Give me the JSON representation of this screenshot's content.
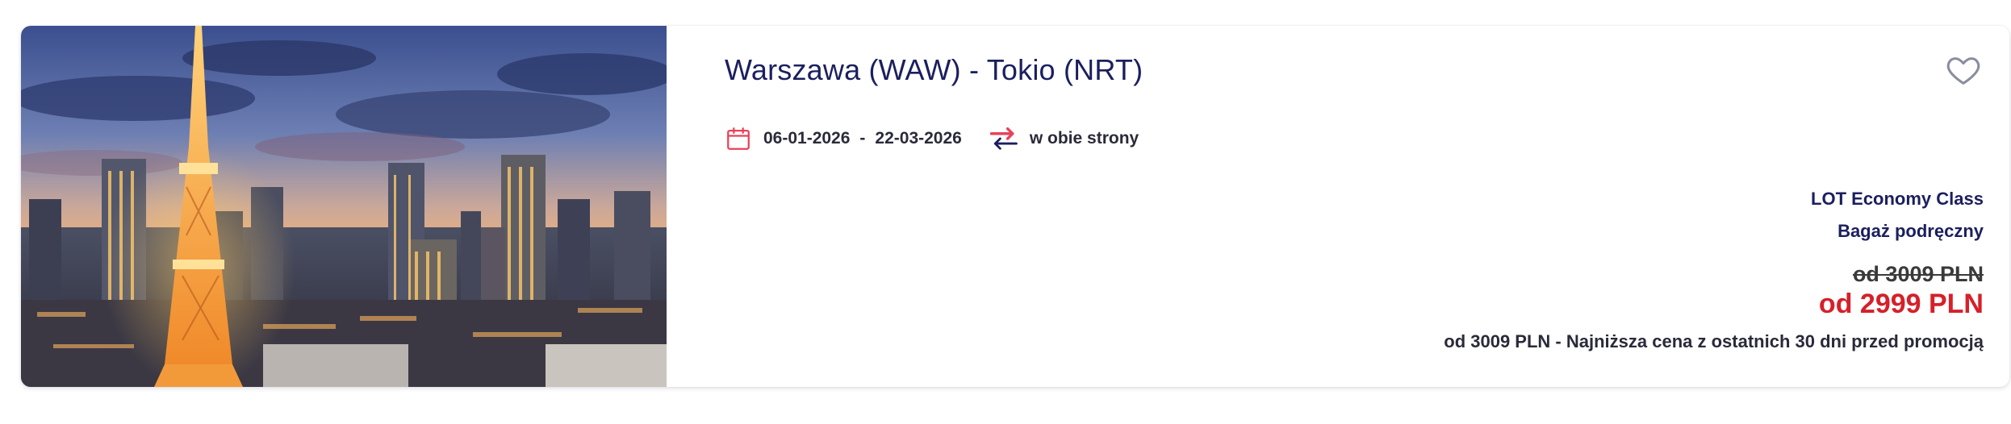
{
  "offer": {
    "image_alt": "Tokio skyline with Tokyo Tower at dusk",
    "title": "Warszawa (WAW) - Tokio (NRT)",
    "date_from": "06-01-2026",
    "date_separator": "-",
    "date_to": "22-03-2026",
    "trip_type": "w obie strony",
    "cabin_class": "LOT Economy Class",
    "baggage": "Bagaż podręczny",
    "old_price": "od 3009 PLN",
    "price": "od 2999 PLN",
    "price_note": "od 3009 PLN - Najniższa cena z ostatnich 30 dni przed promocją"
  },
  "icons": {
    "favorite": "heart-outline-icon",
    "dates": "calendar-icon",
    "trip": "round-trip-arrows-icon"
  },
  "colors": {
    "title": "#1b1f5e",
    "price": "#d6202a",
    "accent": "#e8425a",
    "heart": "#8a8d9e"
  }
}
